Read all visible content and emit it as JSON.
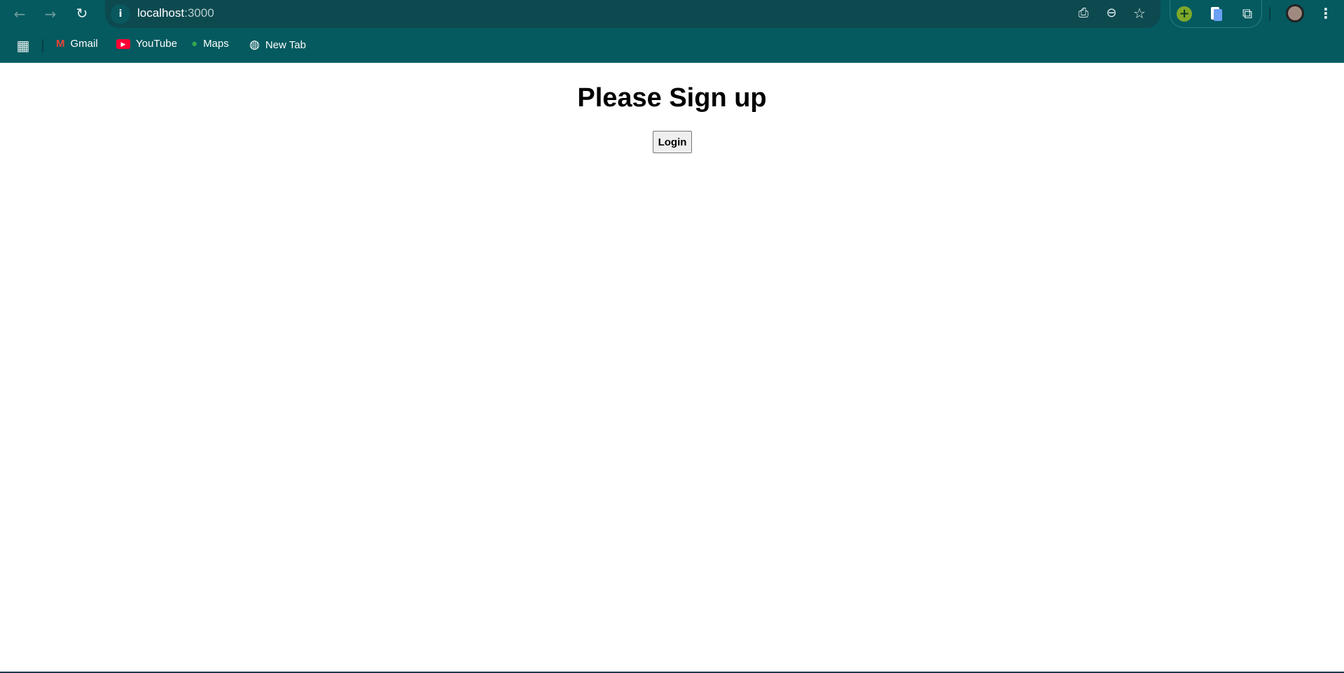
{
  "browser": {
    "url_host": "localhost",
    "url_port": ":3000",
    "colors": {
      "toolbar": "#045a5f",
      "omnibox": "#0c4a50"
    },
    "bookmarks": [
      {
        "label": "Gmail",
        "icon": "gmail-icon"
      },
      {
        "label": "YouTube",
        "icon": "youtube-icon"
      },
      {
        "label": "Maps",
        "icon": "maps-icon"
      },
      {
        "label": "New Tab",
        "icon": "globe-icon"
      }
    ]
  },
  "page": {
    "heading": "Please Sign up",
    "login_label": "Login"
  }
}
